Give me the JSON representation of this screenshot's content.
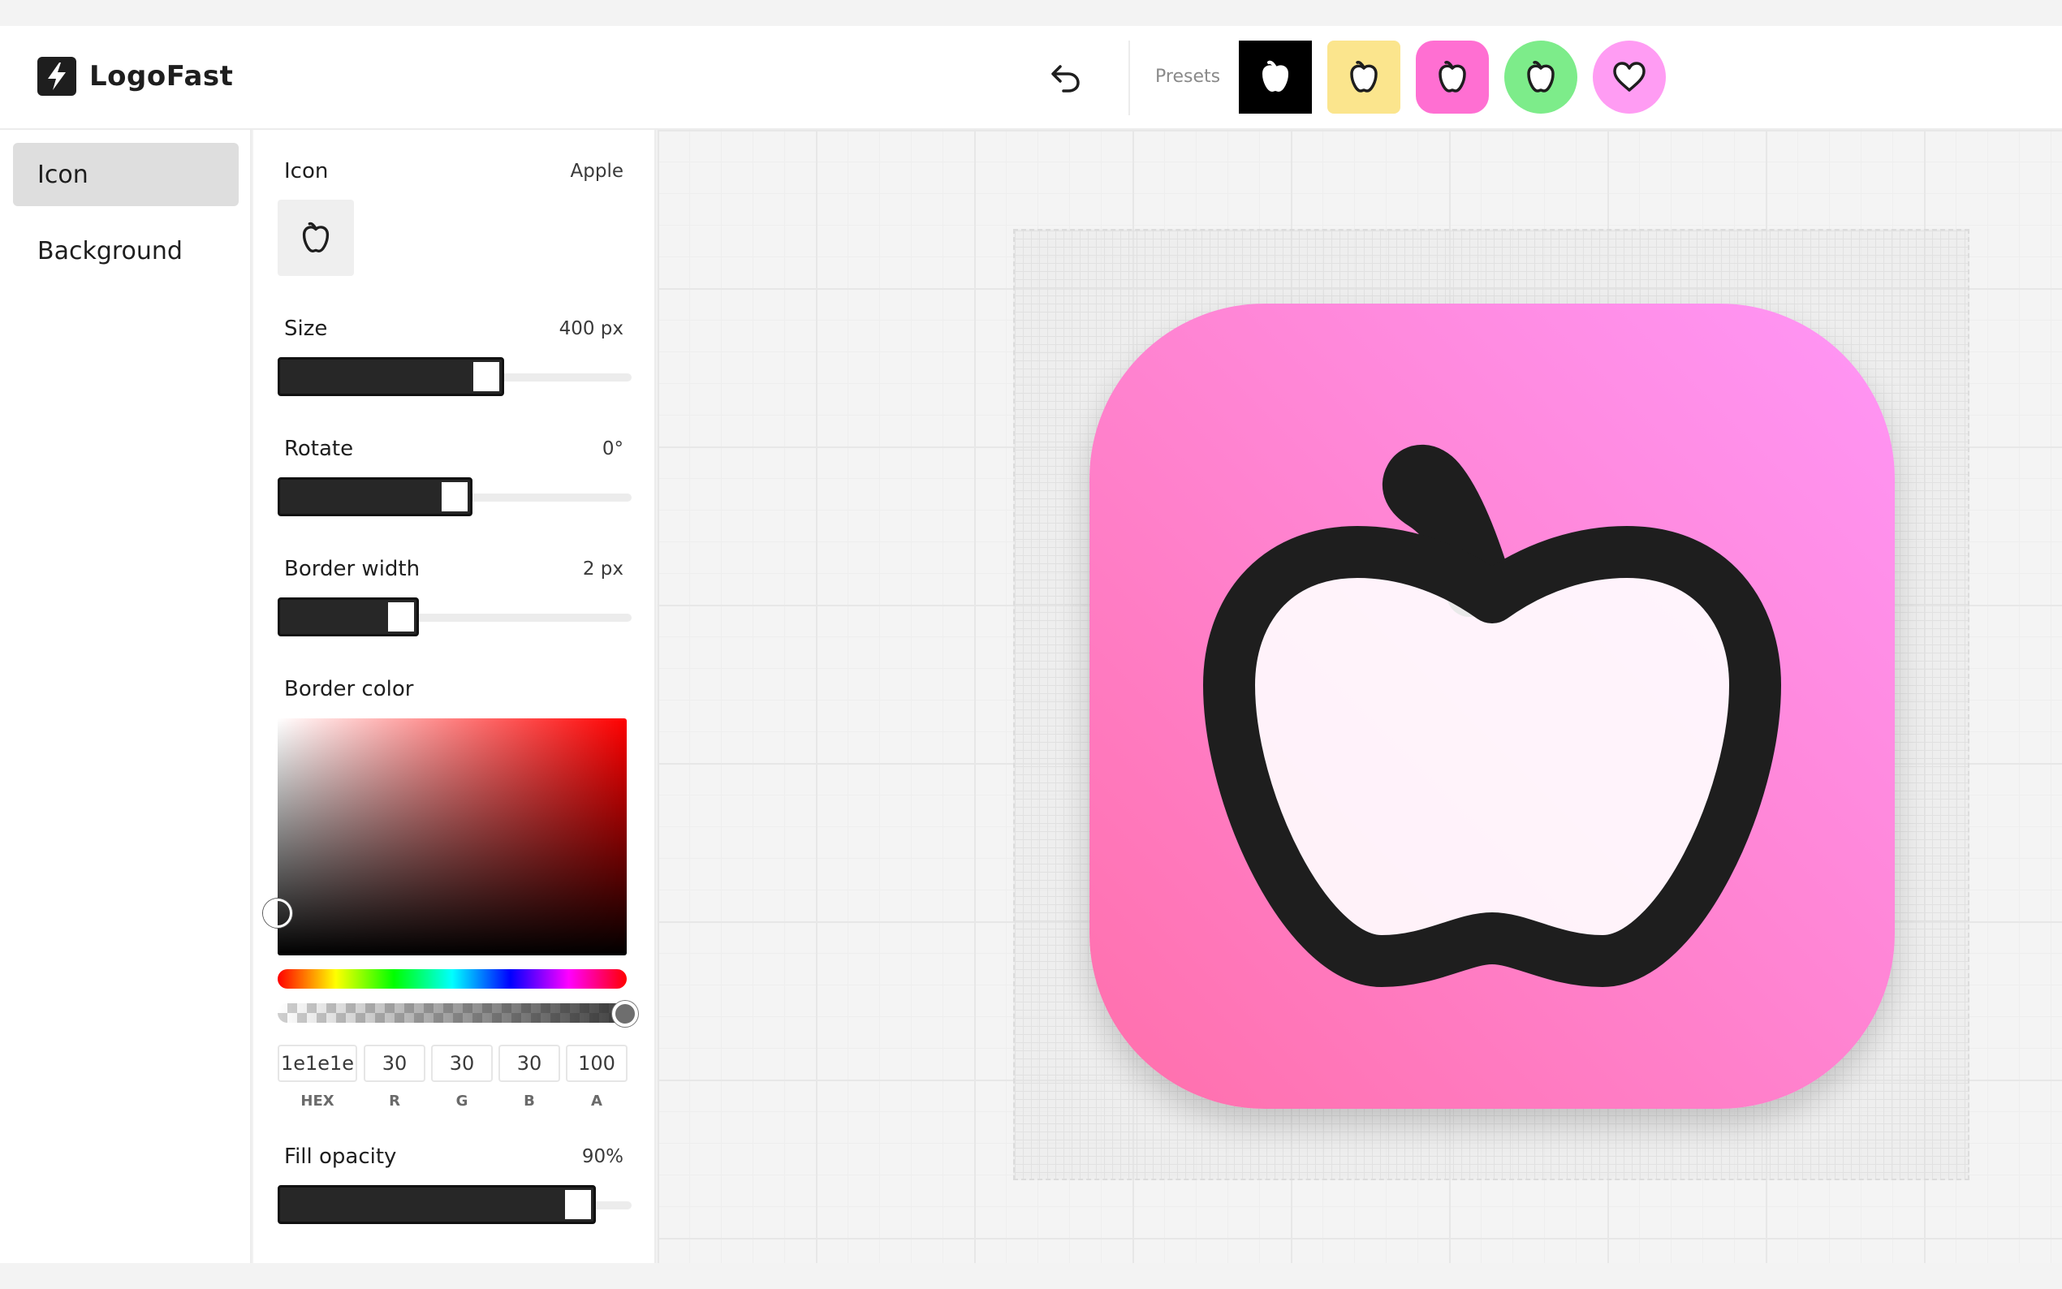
{
  "app": {
    "name": "LogoFast"
  },
  "header": {
    "undo_icon": "undo-icon",
    "presets_label": "Presets",
    "presets": [
      {
        "name": "black-square",
        "bg": "#000000",
        "icon_color": "#ffffff"
      },
      {
        "name": "yellow-square",
        "bg": "#fbe58d",
        "icon_color": "#1e1e1e"
      },
      {
        "name": "pink-rounded",
        "bg": "#ff6fd2",
        "icon_color": "#1e1e1e"
      },
      {
        "name": "green-circle",
        "bg": "#7dec8a",
        "icon_color": "#1e1e1e"
      },
      {
        "name": "pink-circle-heart",
        "bg": "#ff9cf3",
        "icon_color": "#1e1e1e"
      }
    ]
  },
  "nav": {
    "items": [
      {
        "label": "Icon",
        "active": true
      },
      {
        "label": "Background",
        "active": false
      }
    ]
  },
  "panel": {
    "icon": {
      "label": "Icon",
      "value": "Apple",
      "icon_name": "apple-icon"
    },
    "size": {
      "label": "Size",
      "value": "400 px",
      "fraction": 0.64
    },
    "rotate": {
      "label": "Rotate",
      "value": "0°",
      "fraction": 0.55
    },
    "border_width": {
      "label": "Border width",
      "value": "2 px",
      "fraction": 0.4
    },
    "border_color": {
      "label": "Border color",
      "hex": "1e1e1e",
      "r": "30",
      "g": "30",
      "b": "30",
      "a": "100",
      "hex_label": "HEX",
      "r_label": "R",
      "g_label": "G",
      "b_label": "B",
      "a_label": "A",
      "alpha_fraction": 1.0
    },
    "fill_opacity": {
      "label": "Fill opacity",
      "value": "90%",
      "fraction": 0.9
    }
  },
  "canvas": {
    "tile_gradient": [
      "#ff96f7",
      "#ff6fab"
    ],
    "icon_name": "apple-icon",
    "stroke_color": "#1e1e1e",
    "fill_color": "#ffffff"
  }
}
